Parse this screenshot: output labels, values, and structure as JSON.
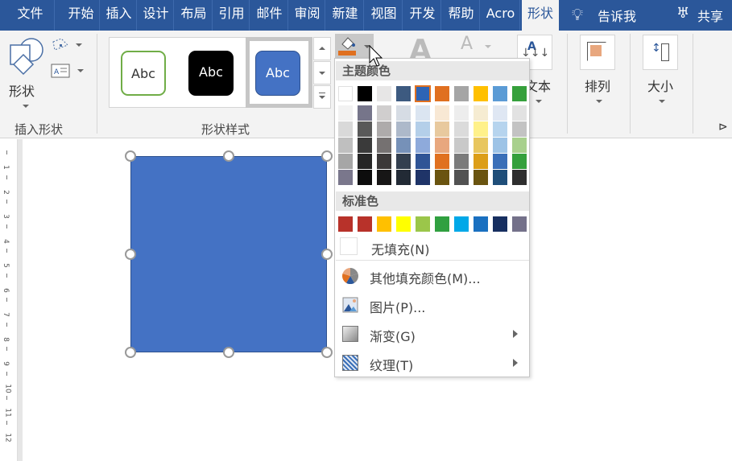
{
  "tabs": [
    {
      "label": "文件"
    },
    {
      "label": "开始"
    },
    {
      "label": "插入"
    },
    {
      "label": "设计"
    },
    {
      "label": "布局"
    },
    {
      "label": "引用"
    },
    {
      "label": "邮件"
    },
    {
      "label": "审阅"
    },
    {
      "label": "新建"
    },
    {
      "label": "视图"
    },
    {
      "label": "开发"
    },
    {
      "label": "帮助"
    },
    {
      "label": "Acro"
    },
    {
      "label": "形状",
      "active": true
    }
  ],
  "tell_me": "告诉我",
  "share": "共享",
  "ribbon": {
    "shapes_button": "形状",
    "insert_shapes_group": "插入形状",
    "shape_styles_group": "形状样式",
    "style_presets": [
      "Abc",
      "Abc",
      "Abc"
    ],
    "text_button": "文本",
    "arrange_button": "排列",
    "size_button": "大小"
  },
  "fill_menu": {
    "theme_colors_header": "主题颜色",
    "standard_colors_header": "标准色",
    "selected_theme_color": "#2e64b5",
    "theme_top": [
      "#ffffff",
      "#000000",
      "#e7e6e6",
      "#3d5a80",
      "#2e64b5",
      "#e07020",
      "#a5a5a5",
      "#ffc000",
      "#5b9bd5",
      "#36a03c"
    ],
    "theme_shades": [
      [
        "#f2f2f2",
        "#76758a",
        "#d0cece",
        "#d6dce4",
        "#dbe5f1",
        "#f8e8d4",
        "#ededed",
        "#f6ecd2",
        "#dfe7f3",
        "#e2e2e2"
      ],
      [
        "#d9d9d9",
        "#595959",
        "#aeabab",
        "#adb9ca",
        "#b4cfe9",
        "#e8c99e",
        "#dbdbdb",
        "#fff18a",
        "#b6d4ee",
        "#c3c3c3"
      ],
      [
        "#bfbfbf",
        "#3a3a3a",
        "#757171",
        "#7691b8",
        "#8eaadb",
        "#e8a77e",
        "#c9c9c9",
        "#e8c65e",
        "#9dc3e6",
        "#a8d08d"
      ],
      [
        "#a6a6a6",
        "#262626",
        "#3b3838",
        "#333f4f",
        "#2f5496",
        "#e07020",
        "#7b7b7b",
        "#dc9e18",
        "#3a6fb8",
        "#34a03c"
      ],
      [
        "#7a778c",
        "#0d0d0d",
        "#171616",
        "#222a35",
        "#1f3468",
        "#6a5410",
        "#525252",
        "#6a5410",
        "#1f4e79",
        "#2e2e2e"
      ]
    ],
    "standard": [
      "#b8322a",
      "#b8322a",
      "#ffc000",
      "#ffff00",
      "#9bc64a",
      "#30a040",
      "#00a8e8",
      "#1a70c0",
      "#172f60",
      "#74718a"
    ],
    "no_fill": "无填充(N)",
    "more_colors": "其他填充颜色(M)...",
    "picture": "图片(P)...",
    "gradient": "渐变(G)",
    "texture": "纹理(T)"
  },
  "ruler_numbers": [
    "1",
    "2",
    "3",
    "4",
    "5",
    "6",
    "7",
    "8",
    "9",
    "10",
    "11",
    "12"
  ],
  "shape": {
    "fill": "#4472c4",
    "outline": "#2f528f"
  }
}
